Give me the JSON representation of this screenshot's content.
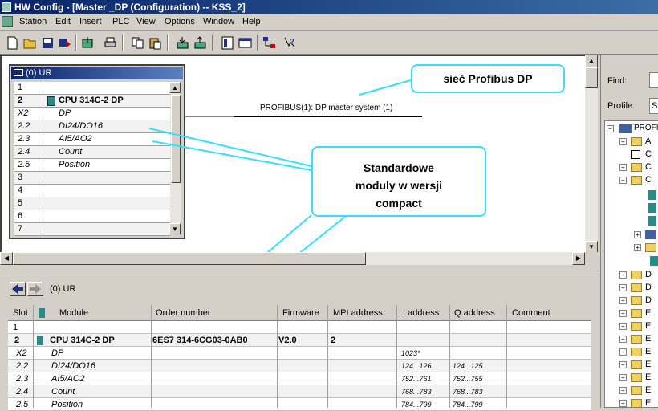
{
  "window": {
    "title": "HW Config - [Master _DP (Configuration) -- KSS_2]"
  },
  "menu": [
    "Station",
    "Edit",
    "Insert",
    "PLC",
    "View",
    "Options",
    "Window",
    "Help"
  ],
  "toolbar": [
    "new-icon",
    "open-icon",
    "save-icon",
    "save-compile-icon",
    "print-icon",
    "copy-icon",
    "paste-icon",
    "download-icon",
    "upload-icon",
    "catalog-icon",
    "overview-icon",
    "network-icon",
    "help-icon"
  ],
  "rack": {
    "title": "(0) UR",
    "rows": [
      {
        "slot": "1",
        "module": ""
      },
      {
        "slot": "2",
        "module": "CPU 314C-2 DP"
      },
      {
        "slot": "X2",
        "module": "DP"
      },
      {
        "slot": "2.2",
        "module": "DI24/DO16"
      },
      {
        "slot": "2.3",
        "module": "AI5/AO2"
      },
      {
        "slot": "2.4",
        "module": "Count"
      },
      {
        "slot": "2.5",
        "module": "Position"
      },
      {
        "slot": "3",
        "module": ""
      },
      {
        "slot": "4",
        "module": ""
      },
      {
        "slot": "5",
        "module": ""
      },
      {
        "slot": "6",
        "module": ""
      },
      {
        "slot": "7",
        "module": ""
      }
    ]
  },
  "network": {
    "label": "PROFIBUS(1): DP master system (1)"
  },
  "callouts": {
    "profibus": "sieć Profibus DP",
    "modules_line1": "Standardowe",
    "modules_line2": "moduly w wersji",
    "modules_line3": "compact"
  },
  "detail": {
    "title": "(0)  UR",
    "headers": {
      "slot": "Slot",
      "module": "Module",
      "order": "Order number",
      "firmware": "Firmware",
      "mpi": "MPI address",
      "i_addr": "I address",
      "q_addr": "Q address",
      "comment": "Comment"
    },
    "rows": [
      {
        "slot": "1",
        "module": "",
        "order": "",
        "firmware": "",
        "mpi": "",
        "i": "",
        "q": ""
      },
      {
        "slot": "2",
        "module": "CPU 314C-2 DP",
        "order": "6ES7 314-6CG03-0AB0",
        "firmware": "V2.0",
        "mpi": "2",
        "i": "",
        "q": ""
      },
      {
        "slot": "X2",
        "module": "DP",
        "order": "",
        "firmware": "",
        "mpi": "",
        "i": "1023*",
        "q": ""
      },
      {
        "slot": "2.2",
        "module": "DI24/DO16",
        "order": "",
        "firmware": "",
        "mpi": "",
        "i": "124...126",
        "q": "124...125"
      },
      {
        "slot": "2.3",
        "module": "AI5/AO2",
        "order": "",
        "firmware": "",
        "mpi": "",
        "i": "752...761",
        "q": "752...755"
      },
      {
        "slot": "2.4",
        "module": "Count",
        "order": "",
        "firmware": "",
        "mpi": "",
        "i": "768...783",
        "q": "768...783"
      },
      {
        "slot": "2.5",
        "module": "Position",
        "order": "",
        "firmware": "",
        "mpi": "",
        "i": "784...799",
        "q": "784...799"
      }
    ]
  },
  "catalog": {
    "find_label": "Find:",
    "profile_label": "Profile:",
    "profile_value": "S",
    "root": "PROFI",
    "letters": [
      "A",
      "C",
      "C",
      "C",
      "",
      "",
      "",
      "",
      "",
      "",
      "D",
      "D",
      "D",
      "E",
      "E",
      "E",
      "E",
      "E",
      "E",
      "E",
      "E"
    ]
  },
  "colors": {
    "callout_border": "#35e0ff",
    "title_blue": "#0a246a"
  }
}
